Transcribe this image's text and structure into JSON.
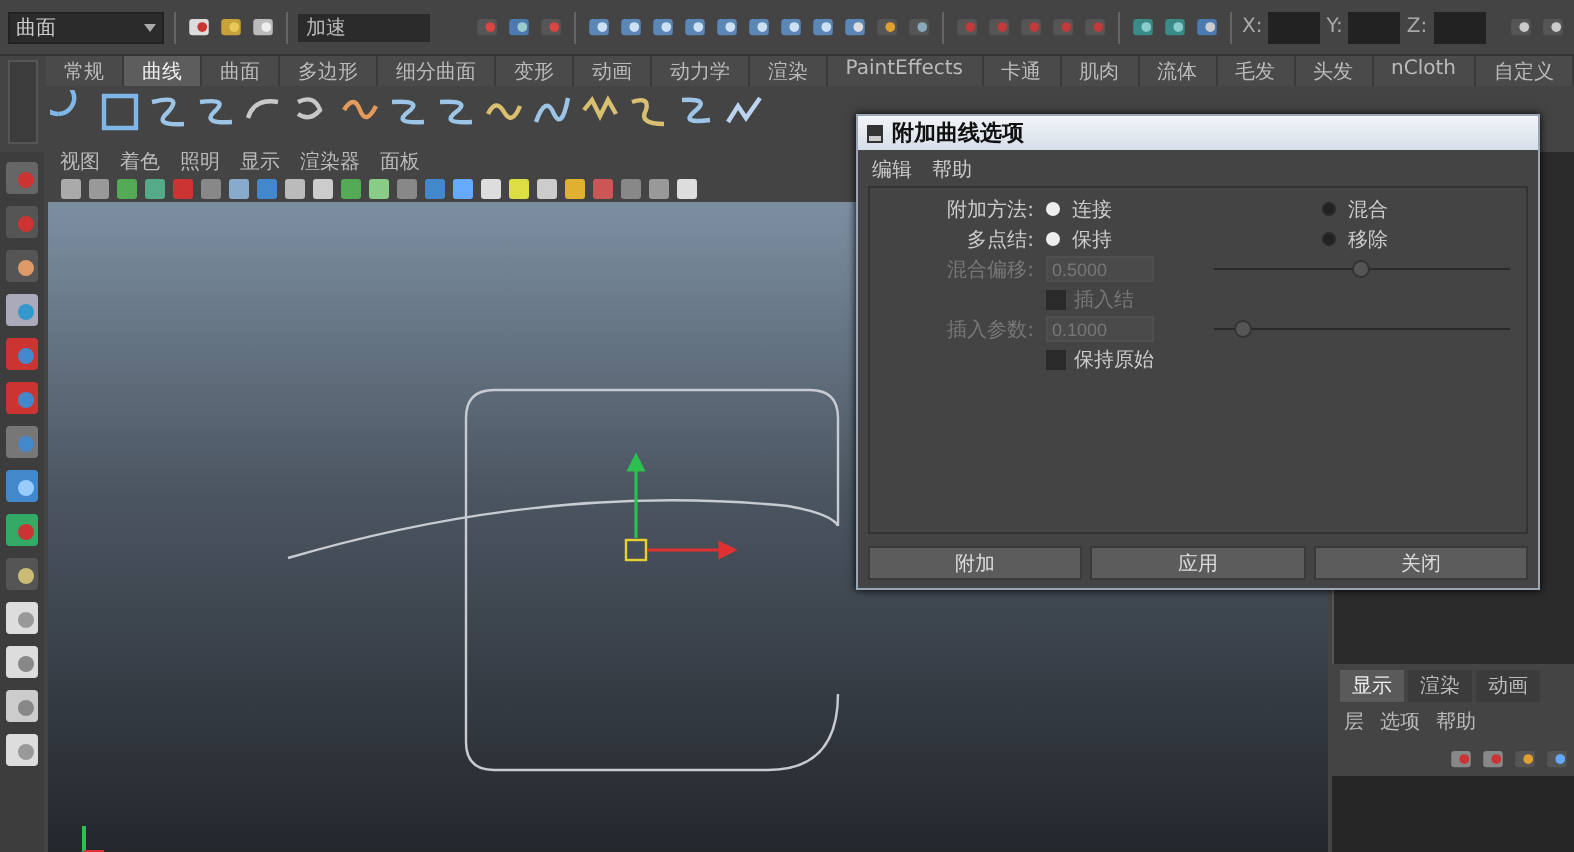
{
  "toolbar": {
    "menu_set": "曲面",
    "name_field": "加速",
    "coord_labels": [
      "X:",
      "Y:",
      "Z:"
    ]
  },
  "shelf": {
    "tabs": [
      {
        "label": "常规",
        "selected": false
      },
      {
        "label": "曲线",
        "selected": true
      },
      {
        "label": "曲面",
        "selected": false
      },
      {
        "label": "多边形",
        "selected": false
      },
      {
        "label": "细分曲面",
        "selected": false
      },
      {
        "label": "变形",
        "selected": false
      },
      {
        "label": "动画",
        "selected": false
      },
      {
        "label": "动力学",
        "selected": false
      },
      {
        "label": "渲染",
        "selected": false
      },
      {
        "label": "PaintEffects",
        "selected": false
      },
      {
        "label": "卡通",
        "selected": false
      },
      {
        "label": "肌肉",
        "selected": false
      },
      {
        "label": "流体",
        "selected": false
      },
      {
        "label": "毛发",
        "selected": false
      },
      {
        "label": "头发",
        "selected": false
      },
      {
        "label": "nCloth",
        "selected": false
      },
      {
        "label": "自定义",
        "selected": false
      }
    ]
  },
  "viewport": {
    "menu": [
      "视图",
      "着色",
      "照明",
      "显示",
      "渲染器",
      "面板"
    ]
  },
  "dialog": {
    "title": "附加曲线选项",
    "menu": [
      "编辑",
      "帮助"
    ],
    "rows": [
      {
        "kind": "radio",
        "label": "附加方法:",
        "disabled": false,
        "options": [
          {
            "label": "连接",
            "selected": true
          },
          {
            "label": "混合",
            "selected": false
          }
        ]
      },
      {
        "kind": "radio",
        "label": "多点结:",
        "disabled": false,
        "options": [
          {
            "label": "保持",
            "selected": true
          },
          {
            "label": "移除",
            "selected": false
          }
        ]
      },
      {
        "kind": "slider",
        "label": "混合偏移:",
        "value": "0.5000",
        "level": 0.5,
        "disabled": true
      },
      {
        "kind": "checkbox",
        "label": "插入结",
        "checked": false,
        "disabled": true
      },
      {
        "kind": "slider",
        "label": "插入参数:",
        "value": "0.1000",
        "level": 0.1,
        "disabled": true
      },
      {
        "kind": "checkbox",
        "label": "保持原始",
        "checked": false,
        "disabled": false
      }
    ],
    "buttons": [
      "附加",
      "应用",
      "关闭"
    ]
  },
  "layer_panel": {
    "tabs": [
      {
        "label": "显示",
        "selected": true
      },
      {
        "label": "渲染",
        "selected": false
      },
      {
        "label": "动画",
        "selected": false
      }
    ],
    "menu": [
      "层",
      "选项",
      "帮助"
    ]
  }
}
